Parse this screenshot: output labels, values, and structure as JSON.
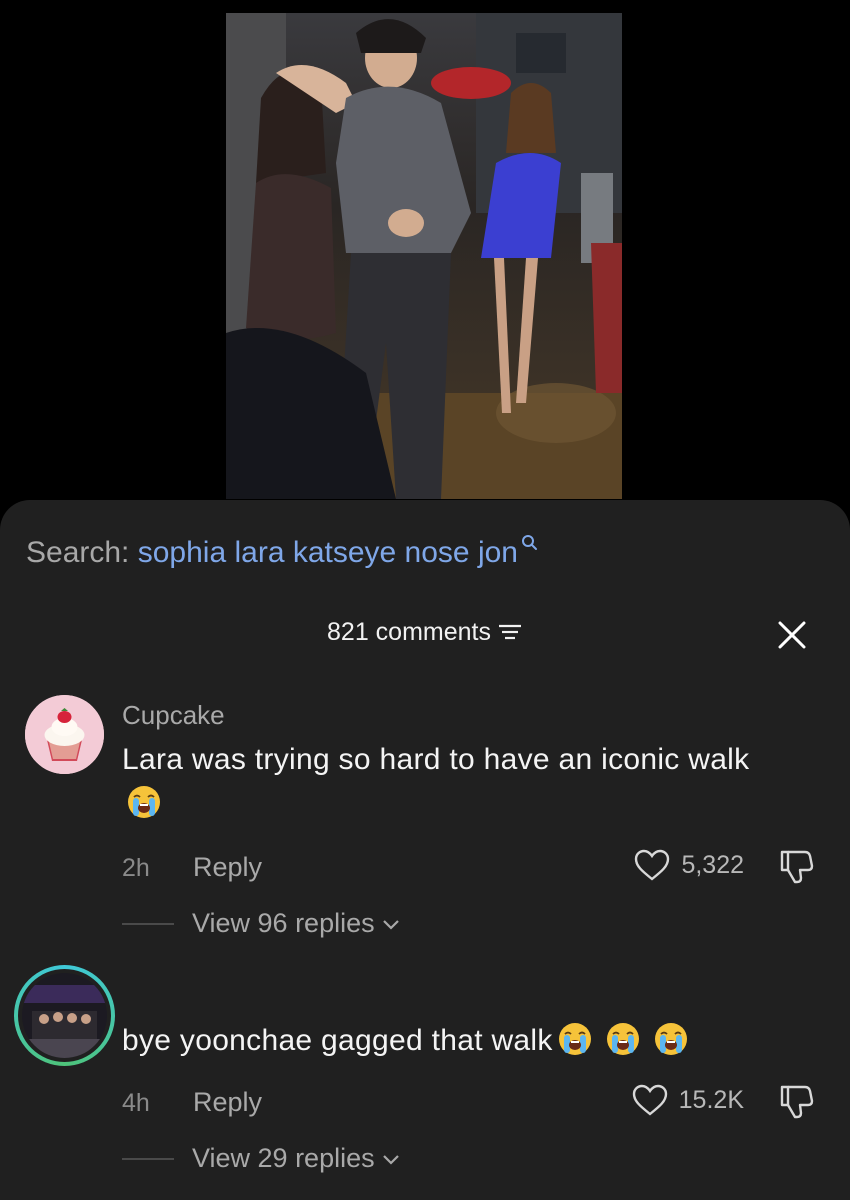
{
  "search": {
    "label": "Search:",
    "query": "sophia lara katseye nose jon"
  },
  "header": {
    "comments_count_label": "821 comments"
  },
  "comments": [
    {
      "username": "Cupcake",
      "text": "Lara was trying so hard to have an iconic walk",
      "emojis": [
        "loudly-crying-face"
      ],
      "time": "2h",
      "reply_label": "Reply",
      "likes": "5,322",
      "view_replies": "View 96 replies"
    },
    {
      "username": "",
      "text": "bye yoonchae gagged that walk",
      "emojis": [
        "loudly-crying-face",
        "loudly-crying-face",
        "loudly-crying-face"
      ],
      "time": "4h",
      "reply_label": "Reply",
      "likes": "15.2K",
      "view_replies": "View 29 replies"
    }
  ],
  "colors": {
    "sheet_bg": "#202020",
    "search_link": "#7fa7e8",
    "muted_text": "#a9a9a9",
    "avatar_ring": "#3fc9d9"
  }
}
